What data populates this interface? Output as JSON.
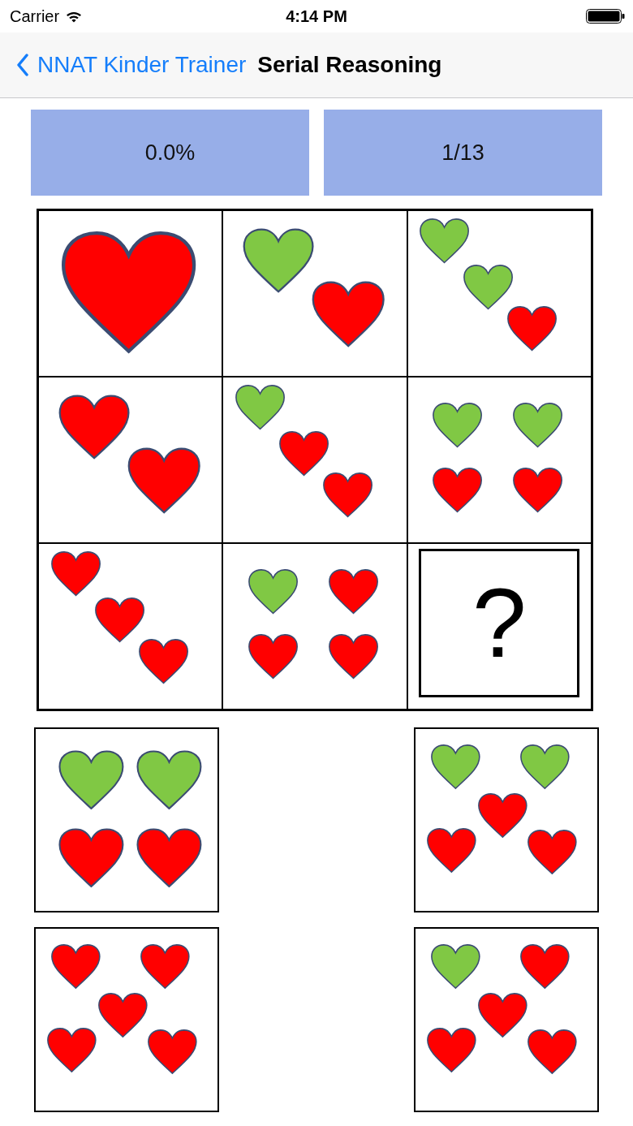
{
  "status_bar": {
    "carrier": "Carrier",
    "time": "4:14 PM"
  },
  "nav_bar": {
    "back_label": "NNAT Kinder Trainer",
    "title": "Serial Reasoning"
  },
  "scores": [
    "0.0%",
    "1/13"
  ],
  "puzzle": {
    "cells": [
      {
        "kind": "single",
        "hearts": [
          {
            "color": "#ff0000"
          }
        ]
      },
      {
        "kind": "pair",
        "hearts": [
          {
            "color": "#80c844"
          },
          {
            "color": "#ff0000"
          }
        ]
      },
      {
        "kind": "diagonal",
        "hearts": [
          {
            "color": "#80c844"
          },
          {
            "color": "#80c844"
          },
          {
            "color": "#ff0000"
          }
        ]
      },
      {
        "kind": "pair",
        "hearts": [
          {
            "color": "#ff0000"
          },
          {
            "color": "#ff0000"
          }
        ]
      },
      {
        "kind": "diagonal",
        "hearts": [
          {
            "color": "#80c844"
          },
          {
            "color": "#ff0000"
          },
          {
            "color": "#ff0000"
          }
        ]
      },
      {
        "kind": "grid",
        "hearts": [
          {
            "color": "#80c844"
          },
          {
            "color": "#80c844"
          },
          {
            "color": "#ff0000"
          },
          {
            "color": "#ff0000"
          }
        ]
      },
      {
        "kind": "diagonal",
        "hearts": [
          {
            "color": "#ff0000"
          },
          {
            "color": "#ff0000"
          },
          {
            "color": "#ff0000"
          }
        ]
      },
      {
        "kind": "grid",
        "hearts": [
          {
            "color": "#80c844"
          },
          {
            "color": "#ff0000"
          },
          {
            "color": "#ff0000"
          },
          {
            "color": "#ff0000"
          }
        ]
      },
      {
        "kind": "question",
        "symbol": "?"
      }
    ]
  },
  "answers": [
    {
      "kind": "grid",
      "hearts": [
        {
          "color": "#80c844"
        },
        {
          "color": "#80c844"
        },
        {
          "color": "#ff0000"
        },
        {
          "color": "#ff0000"
        }
      ]
    },
    {
      "kind": "five",
      "hearts": [
        {
          "color": "#80c844"
        },
        {
          "color": "#80c844"
        },
        {
          "color": "#ff0000"
        },
        {
          "color": "#ff0000"
        },
        {
          "color": "#ff0000"
        }
      ]
    },
    {
      "kind": "five",
      "hearts": [
        {
          "color": "#ff0000"
        },
        {
          "color": "#ff0000"
        },
        {
          "color": "#ff0000"
        },
        {
          "color": "#ff0000"
        },
        {
          "color": "#ff0000"
        }
      ]
    },
    {
      "kind": "five",
      "hearts": [
        {
          "color": "#80c844"
        },
        {
          "color": "#ff0000"
        },
        {
          "color": "#ff0000"
        },
        {
          "color": "#ff0000"
        },
        {
          "color": "#ff0000"
        }
      ]
    }
  ]
}
